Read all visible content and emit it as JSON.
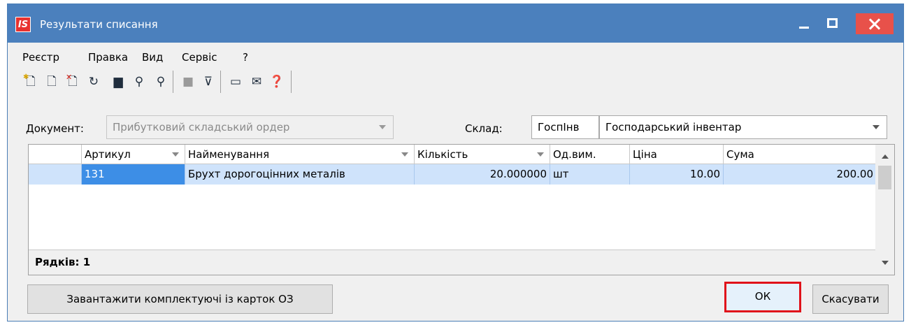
{
  "window": {
    "title": "Результати списання",
    "logo_text": "IS"
  },
  "menu": [
    "Реєстр",
    "Правка",
    "Вид",
    "Сервіс",
    "?"
  ],
  "toolbar": {
    "icons": [
      "add-icon",
      "add-copy-icon",
      "delete-icon",
      "refresh-icon",
      "save-icon",
      "search-icon",
      "find-next-icon",
      "square-icon",
      "clear-filter-icon",
      "form-icon",
      "mail-icon",
      "help-icon"
    ]
  },
  "document": {
    "label": "Документ:",
    "value": "Прибутковий складський ордер"
  },
  "warehouse": {
    "label": "Склад:",
    "code": "ГоспІнв",
    "name": "Господарський інвентар"
  },
  "grid": {
    "columns": [
      "Артикул",
      "Найменування",
      "Кількість",
      "Од.вим.",
      "Ціна",
      "Сума"
    ],
    "rows": [
      {
        "article": "131",
        "name": "Брухт дорогоцінних металів",
        "quantity": "20.000000",
        "unit": "шт",
        "price": "10.00",
        "sum": "200.00"
      }
    ],
    "footer": "Рядків: 1"
  },
  "buttons": {
    "load_components": "Завантажити комплектуючі із карток ОЗ",
    "ok": "ОК",
    "cancel": "Скасувати"
  },
  "colors": {
    "titlebar": "#4b80bd",
    "close_button": "#e8514a",
    "selected_row": "#cfe3fb",
    "focused_cell": "#3d8ee6",
    "highlight_border": "#e0121a"
  }
}
